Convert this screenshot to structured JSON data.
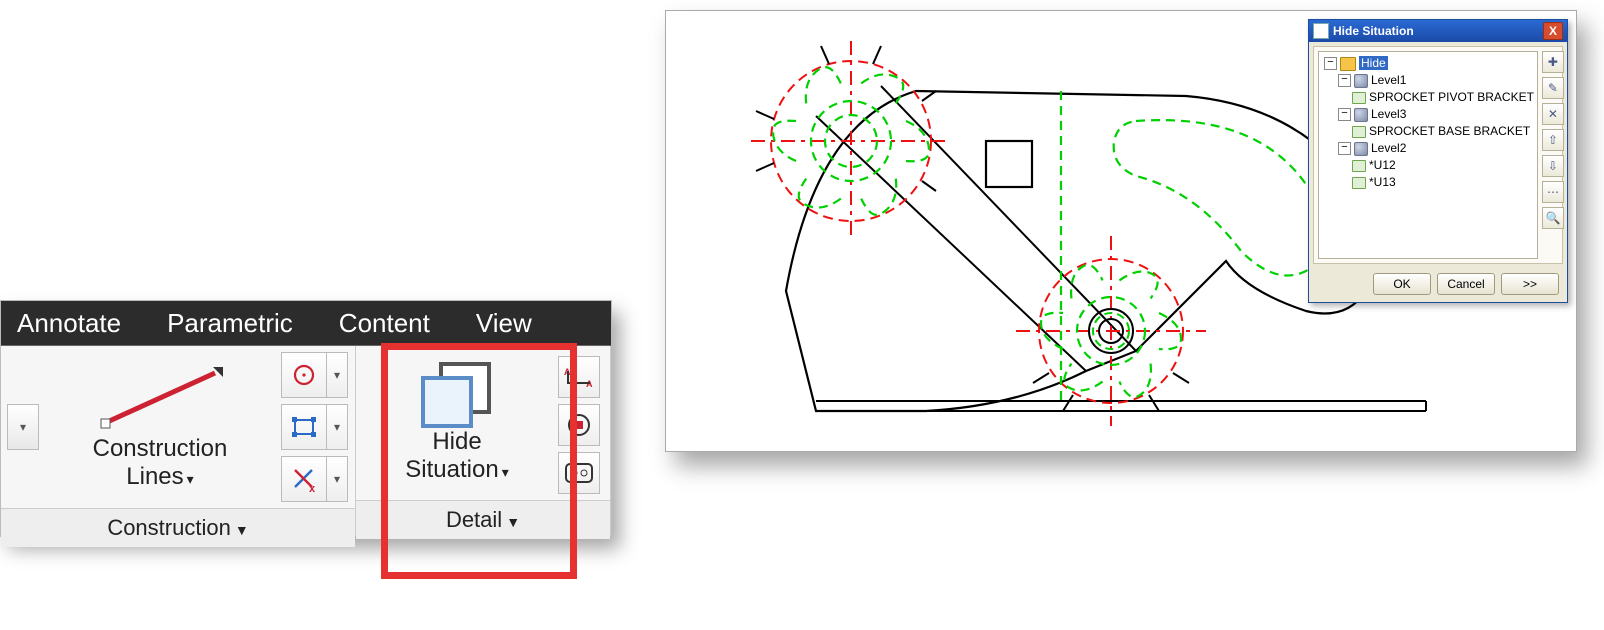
{
  "ribbon": {
    "tabs": [
      "Annotate",
      "Parametric",
      "Content",
      "View"
    ],
    "panels": {
      "construction": {
        "title": "Construction",
        "bigButton": {
          "line1": "Construction",
          "line2": "Lines"
        }
      },
      "detail": {
        "title": "Detail",
        "bigButton": {
          "line1": "Hide",
          "line2": "Situation"
        }
      }
    }
  },
  "dialog": {
    "title": "Hide Situation",
    "tree": {
      "root": "Hide",
      "levels": [
        {
          "name": "Level1",
          "items": [
            "SPROCKET PIVOT BRACKET"
          ]
        },
        {
          "name": "Level3",
          "items": [
            "SPROCKET BASE BRACKET"
          ]
        },
        {
          "name": "Level2",
          "items": [
            "*U12",
            "*U13"
          ]
        }
      ]
    },
    "sideTools": [
      "new-level-icon",
      "edit-icon",
      "delete-icon",
      "move-up-icon",
      "move-down-icon",
      "assign-icon",
      "find-icon"
    ],
    "buttons": {
      "ok": "OK",
      "cancel": "Cancel",
      "more": ">>"
    }
  }
}
